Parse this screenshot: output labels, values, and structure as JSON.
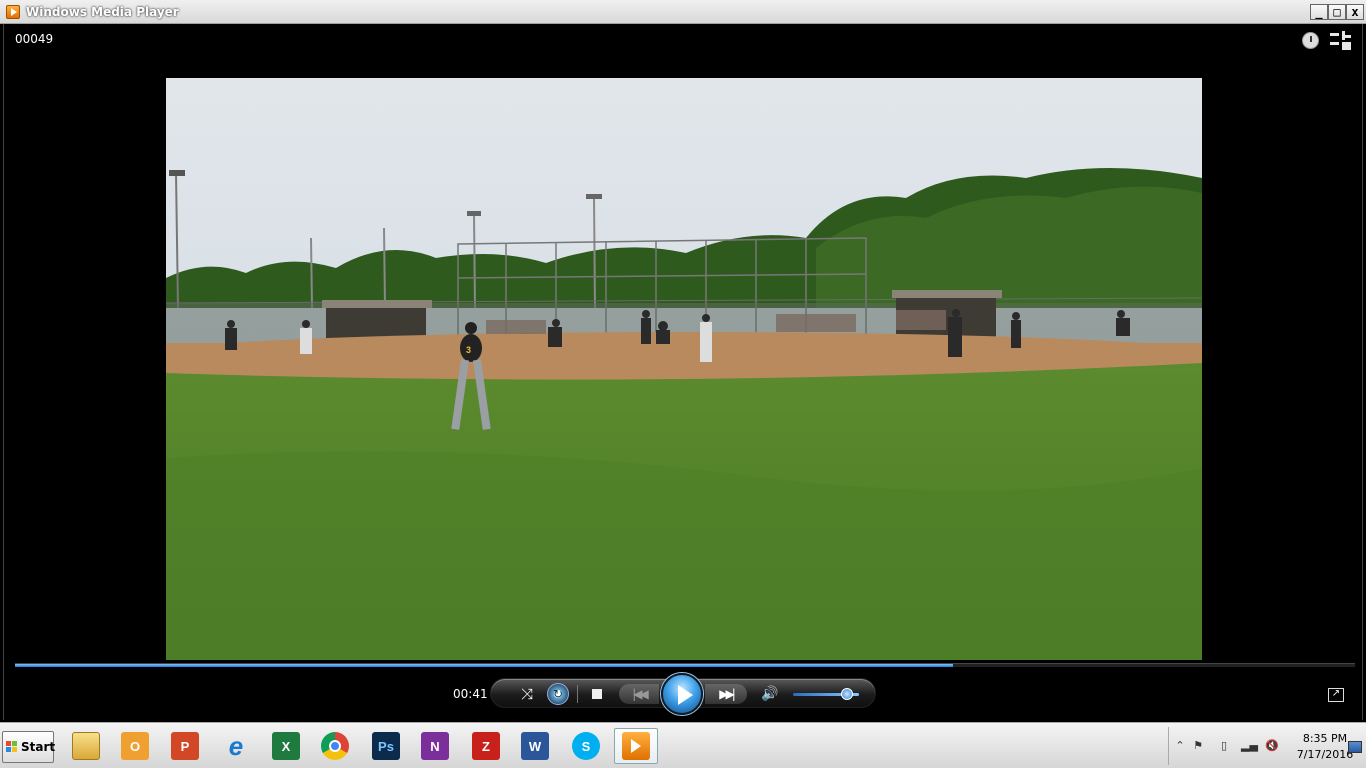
{
  "window": {
    "title": "Windows Media Player"
  },
  "now_playing": {
    "file_name": "00049",
    "current_time": "00:41",
    "progress_fraction": 0.7
  },
  "volume": {
    "level_fraction": 0.82
  },
  "icons": {
    "title": "wmp-icon",
    "shuffle": "shuffle-icon",
    "repeat": "repeat-icon",
    "stop": "stop-icon",
    "previous": "previous-icon",
    "play": "play-icon",
    "next": "next-icon",
    "mute": "speaker-icon"
  },
  "taskbar": {
    "start_label": "Start",
    "apps": [
      {
        "name": "explorer",
        "label": ""
      },
      {
        "name": "outlook",
        "label": "O"
      },
      {
        "name": "powerpoint",
        "label": "P"
      },
      {
        "name": "internet-explorer",
        "label": "e"
      },
      {
        "name": "excel",
        "label": "X"
      },
      {
        "name": "chrome",
        "label": ""
      },
      {
        "name": "photoshop",
        "label": "Ps"
      },
      {
        "name": "onenote",
        "label": "N"
      },
      {
        "name": "filezilla",
        "label": "Z"
      },
      {
        "name": "word",
        "label": "W"
      },
      {
        "name": "skype",
        "label": "S"
      },
      {
        "name": "windows-media-player",
        "label": ""
      }
    ],
    "clock_time": "8:35 PM",
    "clock_date": "7/17/2016"
  },
  "colors": {
    "accent": "#3fa0ea",
    "frame": "#000000"
  }
}
